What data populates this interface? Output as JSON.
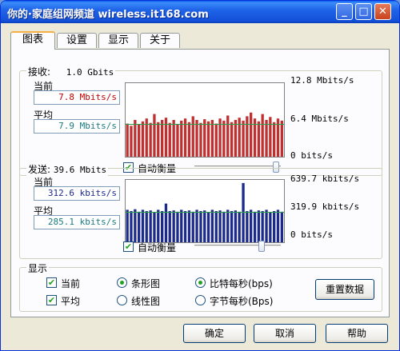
{
  "window": {
    "title": "你的·家庭组网频道 wireless.it168.com"
  },
  "tabs": [
    "图表",
    "设置",
    "显示",
    "关于"
  ],
  "receive": {
    "label": "接收:",
    "max": "1.0 Gbits",
    "current_label": "当前",
    "current_value": "7.8 Mbits/s",
    "average_label": "平均",
    "average_value": "7.9 Mbits/s",
    "scale_top": "12.8 Mbits/s",
    "scale_mid": "6.4 Mbits/s",
    "scale_bottom": "0 bits/s",
    "auto_scale_label": "自动衡量",
    "auto_scale_checked": true,
    "slider_level": 0.98,
    "bar_color": "#c03030",
    "avg_line_color": "#2aa04a"
  },
  "send": {
    "label": "发送:",
    "max": "39.6 Mbits",
    "current_label": "当前",
    "current_value": "312.6 kbits/s",
    "average_label": "平均",
    "average_value": "285.1 kbits/s",
    "scale_top": "639.7 kbits/s",
    "scale_mid": "319.9 kbits/s",
    "scale_bottom": "0 bits/s",
    "auto_scale_label": "自动衡量",
    "auto_scale_checked": true,
    "slider_level": 0.8,
    "bar_color": "#1c2a8c",
    "avg_line_color": "#2aa04a"
  },
  "display": {
    "label": "显示",
    "show_current": "当前",
    "show_average": "平均",
    "bar_chart": "条形图",
    "line_chart": "线性图",
    "bits_per_sec": "比特每秒(bps)",
    "bytes_per_sec": "字节每秒(Bps)",
    "reset": "重置数据"
  },
  "buttons": {
    "ok": "确定",
    "cancel": "取消",
    "help": "帮助"
  }
}
